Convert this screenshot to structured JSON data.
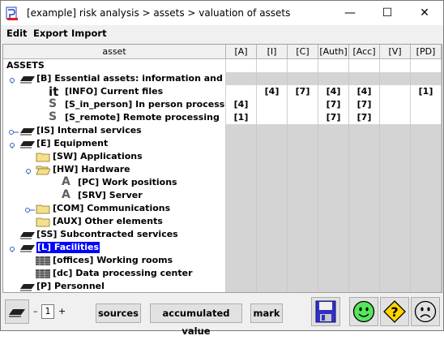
{
  "window": {
    "title": "[example] risk analysis > assets > valuation of assets",
    "minimize_glyph": "—",
    "maximize_glyph": "☐",
    "close_glyph": "✕"
  },
  "menu": {
    "items": [
      "Edit",
      "Export",
      "Import"
    ]
  },
  "table": {
    "asset_header": "asset",
    "columns": [
      "[A]",
      "[I]",
      "[C]",
      "[Auth]",
      "[Acc]",
      "[V]",
      "[PD]"
    ],
    "rows": [
      {
        "label": "ASSETS",
        "icon": "none",
        "values": [
          "",
          "",
          "",
          "",
          "",
          "",
          ""
        ]
      },
      {
        "label": "[B] Essential assets: information and services",
        "icon": "layer-icon",
        "values": [
          "",
          "",
          "",
          "",
          "",
          "",
          ""
        ]
      },
      {
        "label": "[INFO] Current files",
        "icon": "info-icon",
        "icon_text": "it",
        "values": [
          "",
          "[4]",
          "[7]",
          "[4]",
          "[4]",
          "",
          "[1]"
        ]
      },
      {
        "label": "[S_in_person] In person processing",
        "icon": "service-icon",
        "icon_text": "S",
        "values": [
          "[4]",
          "",
          "",
          "[7]",
          "[7]",
          "",
          ""
        ]
      },
      {
        "label": "[S_remote] Remote processing",
        "icon": "service-icon",
        "icon_text": "S",
        "values": [
          "[1]",
          "",
          "",
          "[7]",
          "[7]",
          "",
          ""
        ]
      },
      {
        "label": "[IS] Internal services",
        "icon": "layer-icon",
        "values": [
          "",
          "",
          "",
          "",
          "",
          "",
          ""
        ]
      },
      {
        "label": "[E] Equipment",
        "icon": "layer-icon",
        "values": [
          "",
          "",
          "",
          "",
          "",
          "",
          ""
        ]
      },
      {
        "label": "[SW] Applications",
        "icon": "folder-icon",
        "values": [
          "",
          "",
          "",
          "",
          "",
          "",
          ""
        ]
      },
      {
        "label": "[HW] Hardware",
        "icon": "folder-open-icon",
        "values": [
          "",
          "",
          "",
          "",
          "",
          "",
          ""
        ]
      },
      {
        "label": "[PC] Work positions",
        "icon": "hardware-icon",
        "icon_text": "A",
        "values": [
          "",
          "",
          "",
          "",
          "",
          "",
          ""
        ]
      },
      {
        "label": "[SRV] Server",
        "icon": "hardware-icon",
        "icon_text": "A",
        "values": [
          "",
          "",
          "",
          "",
          "",
          "",
          ""
        ]
      },
      {
        "label": "[COM] Communications",
        "icon": "folder-icon",
        "values": [
          "",
          "",
          "",
          "",
          "",
          "",
          ""
        ]
      },
      {
        "label": "[AUX] Other elements",
        "icon": "folder-icon",
        "values": [
          "",
          "",
          "",
          "",
          "",
          "",
          ""
        ]
      },
      {
        "label": "[SS] Subcontracted services",
        "icon": "layer-icon",
        "values": [
          "",
          "",
          "",
          "",
          "",
          "",
          ""
        ]
      },
      {
        "label": "[L] Facilities",
        "icon": "layer-icon",
        "values": [
          "",
          "",
          "",
          "",
          "",
          "",
          ""
        ]
      },
      {
        "label": "[offices] Working rooms",
        "icon": "building-icon",
        "values": [
          "",
          "",
          "",
          "",
          "",
          "",
          ""
        ]
      },
      {
        "label": "[dc] Data processing center",
        "icon": "building-icon",
        "values": [
          "",
          "",
          "",
          "",
          "",
          "",
          ""
        ]
      },
      {
        "label": "[P] Personnel",
        "icon": "layer-icon",
        "values": [
          "",
          "",
          "",
          "",
          "",
          "",
          ""
        ]
      }
    ]
  },
  "toolbar": {
    "minus": "–",
    "level": "1",
    "plus": "+",
    "sources_label": "sources",
    "accumulated_label": "accumulated value",
    "mark_label": "mark",
    "question_glyph": "?"
  },
  "colors": {
    "selection": "#0000ff",
    "gray_cell": "#d4d4d4",
    "folder": "#f5e08a",
    "smiley": "#57e65b",
    "warning": "#ffd400"
  }
}
